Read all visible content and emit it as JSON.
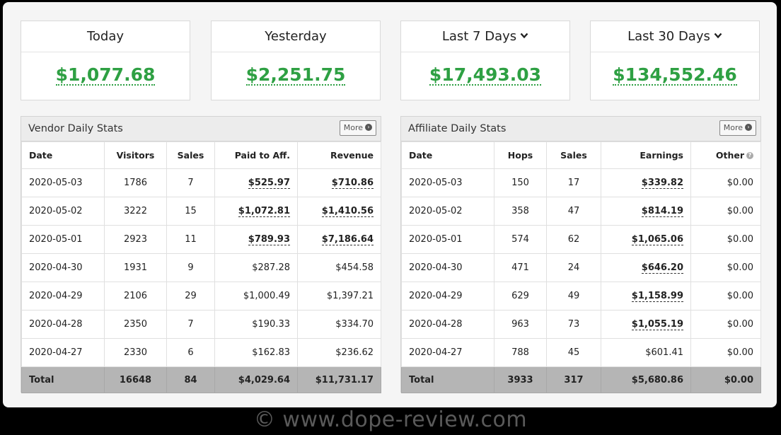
{
  "cards": [
    {
      "label": "Today",
      "value": "$1,077.68",
      "dropdown": false
    },
    {
      "label": "Yesterday",
      "value": "$2,251.75",
      "dropdown": false
    },
    {
      "label": "Last 7 Days",
      "value": "$17,493.03",
      "dropdown": true
    },
    {
      "label": "Last 30 Days",
      "value": "$134,552.46",
      "dropdown": true
    }
  ],
  "vendor": {
    "title": "Vendor Daily Stats",
    "more_label": "More",
    "headers": [
      "Date",
      "Visitors",
      "Sales",
      "Paid to Aff.",
      "Revenue"
    ],
    "rows": [
      [
        "2020-05-03",
        "1786",
        "7",
        "$525.97",
        "$710.86"
      ],
      [
        "2020-05-02",
        "3222",
        "15",
        "$1,072.81",
        "$1,410.56"
      ],
      [
        "2020-05-01",
        "2923",
        "11",
        "$789.93",
        "$7,186.64"
      ],
      [
        "2020-04-30",
        "1931",
        "9",
        "$287.28",
        "$454.58"
      ],
      [
        "2020-04-29",
        "2106",
        "29",
        "$1,000.49",
        "$1,397.21"
      ],
      [
        "2020-04-28",
        "2350",
        "7",
        "$190.33",
        "$334.70"
      ],
      [
        "2020-04-27",
        "2330",
        "6",
        "$162.83",
        "$236.62"
      ]
    ],
    "linked_rows": 3,
    "total": [
      "Total",
      "16648",
      "84",
      "$4,029.64",
      "$11,731.17"
    ]
  },
  "affiliate": {
    "title": "Affiliate Daily Stats",
    "more_label": "More",
    "headers": [
      "Date",
      "Hops",
      "Sales",
      "Earnings",
      "Other"
    ],
    "rows": [
      [
        "2020-05-03",
        "150",
        "17",
        "$339.82",
        "$0.00"
      ],
      [
        "2020-05-02",
        "358",
        "47",
        "$814.19",
        "$0.00"
      ],
      [
        "2020-05-01",
        "574",
        "62",
        "$1,065.06",
        "$0.00"
      ],
      [
        "2020-04-30",
        "471",
        "24",
        "$646.20",
        "$0.00"
      ],
      [
        "2020-04-29",
        "629",
        "49",
        "$1,158.99",
        "$0.00"
      ],
      [
        "2020-04-28",
        "963",
        "73",
        "$1,055.19",
        "$0.00"
      ],
      [
        "2020-04-27",
        "788",
        "45",
        "$601.41",
        "$0.00"
      ]
    ],
    "linked_rows": 6,
    "total": [
      "Total",
      "3933",
      "317",
      "$5,680.86",
      "$0.00"
    ]
  },
  "watermark": "© www.dope-review.com",
  "colors": {
    "accent_green": "#2ea043",
    "total_row": "#b5b5b5"
  }
}
